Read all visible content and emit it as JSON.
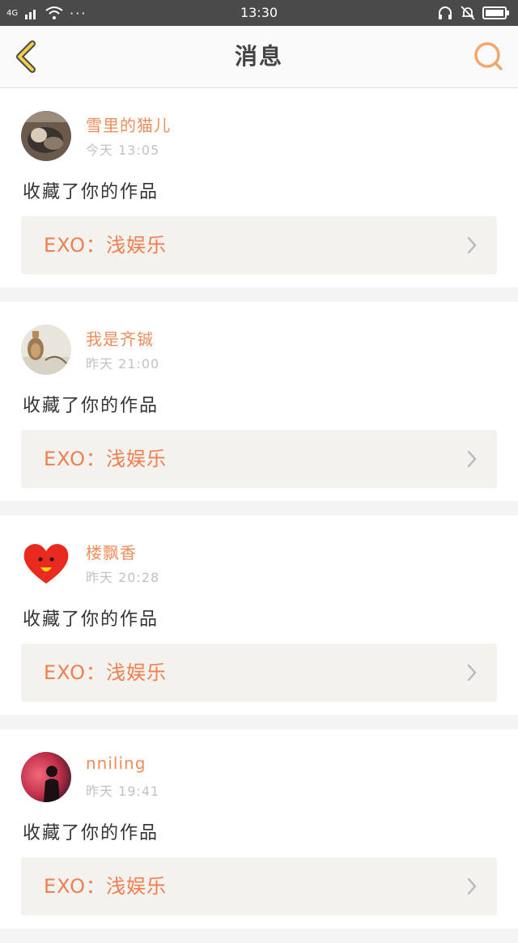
{
  "status_bar": {
    "network": "4G",
    "time": "13:30",
    "more": "···"
  },
  "header": {
    "title": "消息"
  },
  "colors": {
    "accent": "#ee8d5b",
    "work_title": "#f07e4f",
    "back_arrow": "#f1cf45"
  },
  "messages": [
    {
      "user": "雪里的猫儿",
      "time": "今天 13:05",
      "action": "收藏了你的作品",
      "work": "EXO：浅娱乐",
      "avatar": "cat-avatar"
    },
    {
      "user": "我是齐铖",
      "time": "昨天 21:00",
      "action": "收藏了你的作品",
      "work": "EXO：浅娱乐",
      "avatar": "bottle-avatar"
    },
    {
      "user": "楼飘香",
      "time": "昨天 20:28",
      "action": "收藏了你的作品",
      "work": "EXO：浅娱乐",
      "avatar": "heart-avatar"
    },
    {
      "user": "nniling",
      "time": "昨天 19:41",
      "action": "收藏了你的作品",
      "work": "EXO：浅娱乐",
      "avatar": "person-avatar"
    }
  ]
}
